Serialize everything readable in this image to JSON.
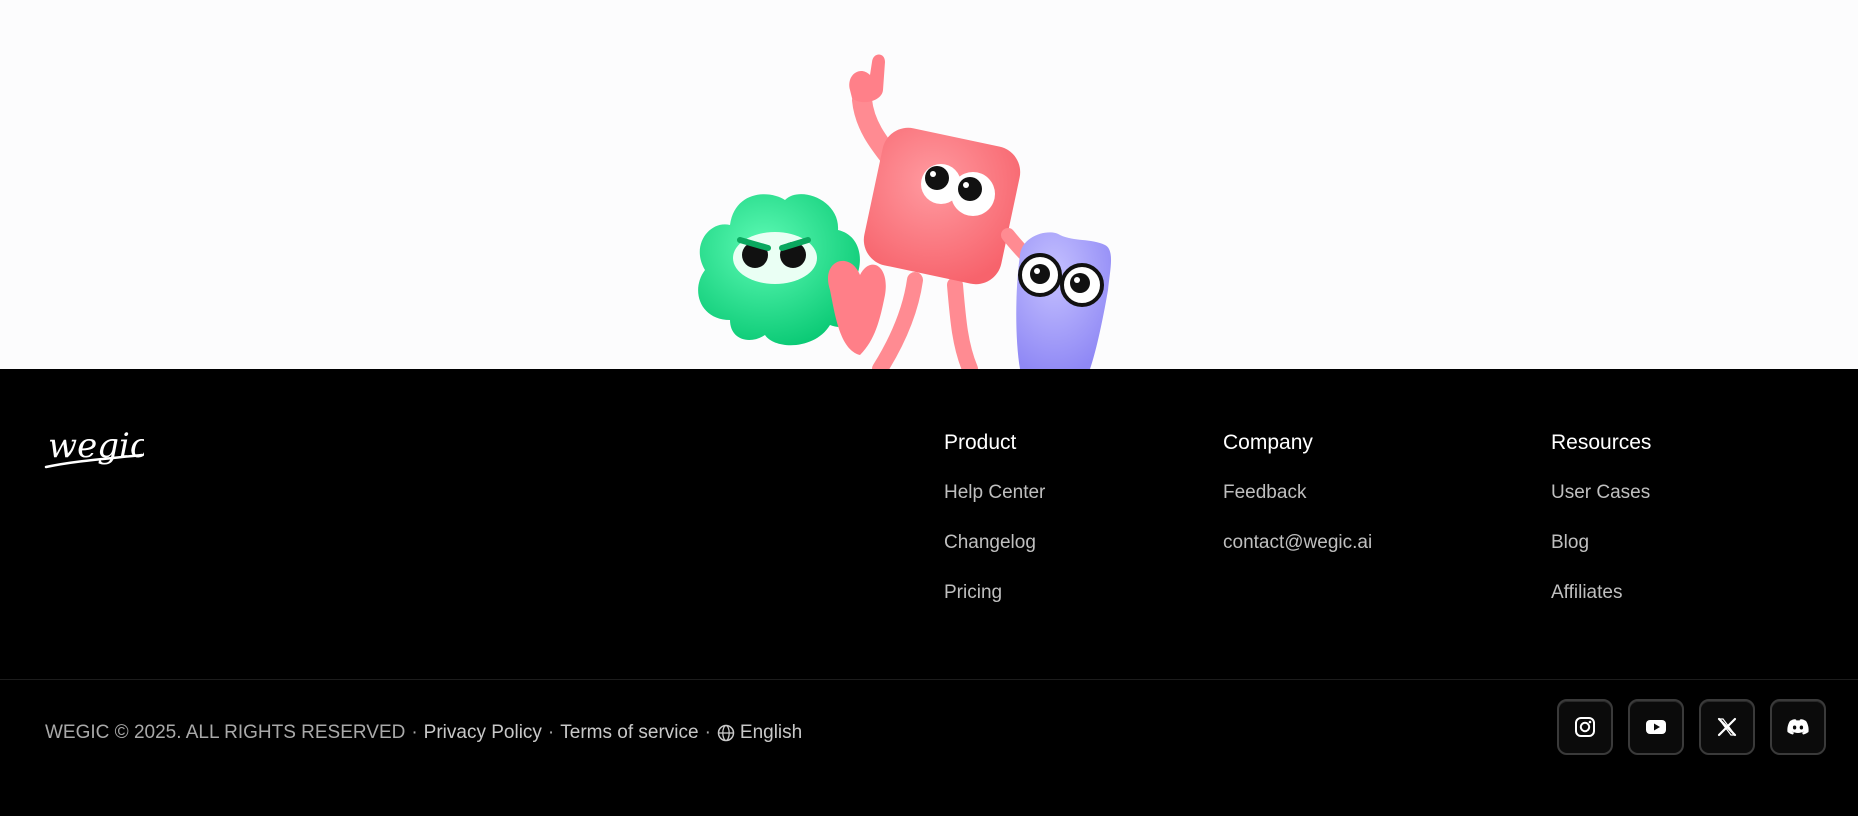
{
  "brand": {
    "logo_text": "wegic"
  },
  "footer": {
    "columns": [
      {
        "title": "Product",
        "links": [
          "Help Center",
          "Changelog",
          "Pricing"
        ]
      },
      {
        "title": "Company",
        "links": [
          "Feedback",
          "contact@wegic.ai"
        ]
      },
      {
        "title": "Resources",
        "links": [
          "User Cases",
          "Blog",
          "Affiliates"
        ]
      }
    ],
    "copyright": "WEGIC © 2025. ALL RIGHTS RESERVED",
    "separator": "·",
    "privacy_label": "Privacy Policy",
    "terms_label": "Terms of service",
    "language_label": "English",
    "socials": [
      {
        "icon": "instagram-icon"
      },
      {
        "icon": "youtube-icon"
      },
      {
        "icon": "x-icon"
      },
      {
        "icon": "discord-icon"
      }
    ]
  },
  "colors": {
    "hero_bg": "#fcfcfd",
    "footer_bg": "#000000",
    "mascot_green": "#1ee08a",
    "mascot_pink": "#ff7f86",
    "mascot_purple": "#a9a3ff"
  }
}
